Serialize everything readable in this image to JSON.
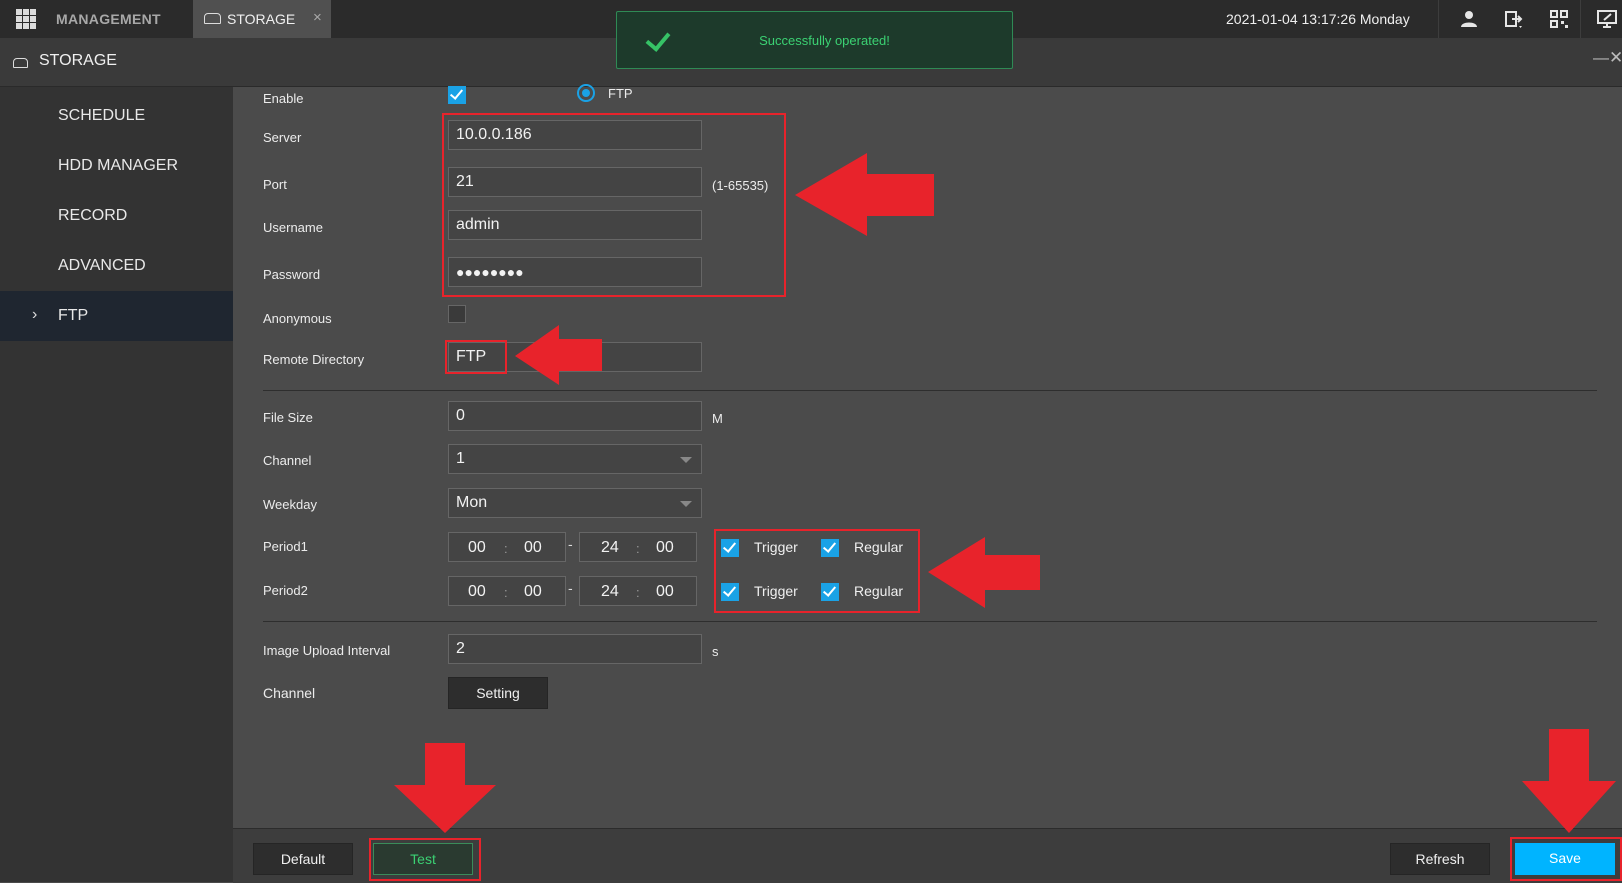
{
  "topbar": {
    "management_label": "MANAGEMENT",
    "tab_label": "STORAGE",
    "tab_close": "×",
    "datetime": "2021-01-04 13:17:26 Monday",
    "icons": [
      "user-icon",
      "logout-icon",
      "qr-code-icon",
      "monitor-icon"
    ]
  },
  "toast": {
    "message": "Successfully operated!",
    "icon": "check-icon"
  },
  "subheader": {
    "title": "STORAGE",
    "minimize": "—",
    "close": "✕"
  },
  "sidebar": {
    "items": [
      {
        "label": "SCHEDULE",
        "active": false
      },
      {
        "label": "HDD MANAGER",
        "active": false
      },
      {
        "label": "RECORD",
        "active": false
      },
      {
        "label": "ADVANCED",
        "active": false
      },
      {
        "label": "FTP",
        "active": true
      }
    ],
    "active_chevron": "›"
  },
  "form": {
    "enable": {
      "label": "Enable",
      "checked": true
    },
    "protocol": {
      "label": "FTP",
      "selected": true
    },
    "server": {
      "label": "Server",
      "value": "10.0.0.186"
    },
    "port": {
      "label": "Port",
      "value": "21",
      "hint": "(1-65535)"
    },
    "username": {
      "label": "Username",
      "value": "admin"
    },
    "password": {
      "label": "Password",
      "value": "●●●●●●●●"
    },
    "anonymous": {
      "label": "Anonymous",
      "checked": false
    },
    "remote_directory": {
      "label": "Remote Directory",
      "value": "FTP"
    },
    "file_size": {
      "label": "File Size",
      "value": "0",
      "unit": "M"
    },
    "channel": {
      "label": "Channel",
      "value": "1"
    },
    "weekday": {
      "label": "Weekday",
      "value": "Mon"
    },
    "period1": {
      "label": "Period1",
      "start_h": "00",
      "start_m": "00",
      "end_h": "24",
      "end_m": "00",
      "trigger": {
        "label": "Trigger",
        "checked": true
      },
      "regular": {
        "label": "Regular",
        "checked": true
      }
    },
    "period2": {
      "label": "Period2",
      "start_h": "00",
      "start_m": "00",
      "end_h": "24",
      "end_m": "00",
      "trigger": {
        "label": "Trigger",
        "checked": true
      },
      "regular": {
        "label": "Regular",
        "checked": true
      }
    },
    "time_colon": ":",
    "time_dash": "-",
    "image_upload_interval": {
      "label": "Image Upload Interval",
      "value": "2",
      "unit": "s"
    },
    "channel_setting": {
      "label": "Channel",
      "button": "Setting"
    }
  },
  "footer": {
    "default_button": "Default",
    "test_button": "Test",
    "refresh_button": "Refresh",
    "save_button": "Save"
  },
  "colors": {
    "accent": "#1aa2e6",
    "annotation_red": "#e8232b",
    "success_green": "#3bd173",
    "save_blue": "#00b4ff"
  }
}
